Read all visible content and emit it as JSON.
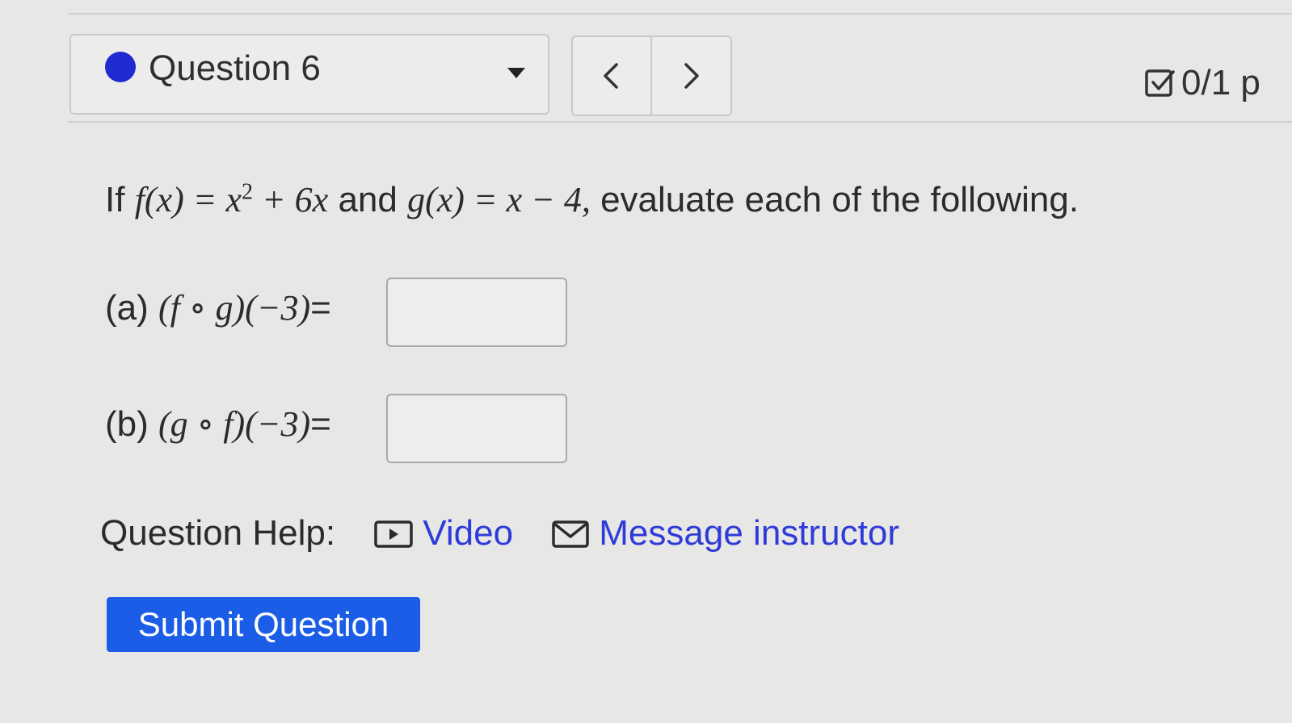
{
  "header": {
    "question_label": "Question 6",
    "prev_symbol": "<",
    "next_symbol": ">",
    "score": "0/1 p"
  },
  "question": {
    "statement": {
      "if": "If",
      "f_def": "f(x) = x",
      "exp": "2",
      "f_tail": " + 6x",
      "and": "and",
      "g_def": "g(x) = x − 4,",
      "rest": "evaluate each of the following."
    },
    "part_a": {
      "label": "(a)",
      "expr": "(f ∘ g)(−3)",
      "eq": "=",
      "value": ""
    },
    "part_b": {
      "label": "(b)",
      "expr": "(g ∘ f)(−3)",
      "eq": "=",
      "value": ""
    }
  },
  "help": {
    "label": "Question Help:",
    "video": "Video",
    "message": "Message instructor"
  },
  "submit_label": "Submit Question",
  "colors": {
    "accent": "#1b5de6",
    "link": "#2f3bd8",
    "dot": "#1f2bd1"
  }
}
